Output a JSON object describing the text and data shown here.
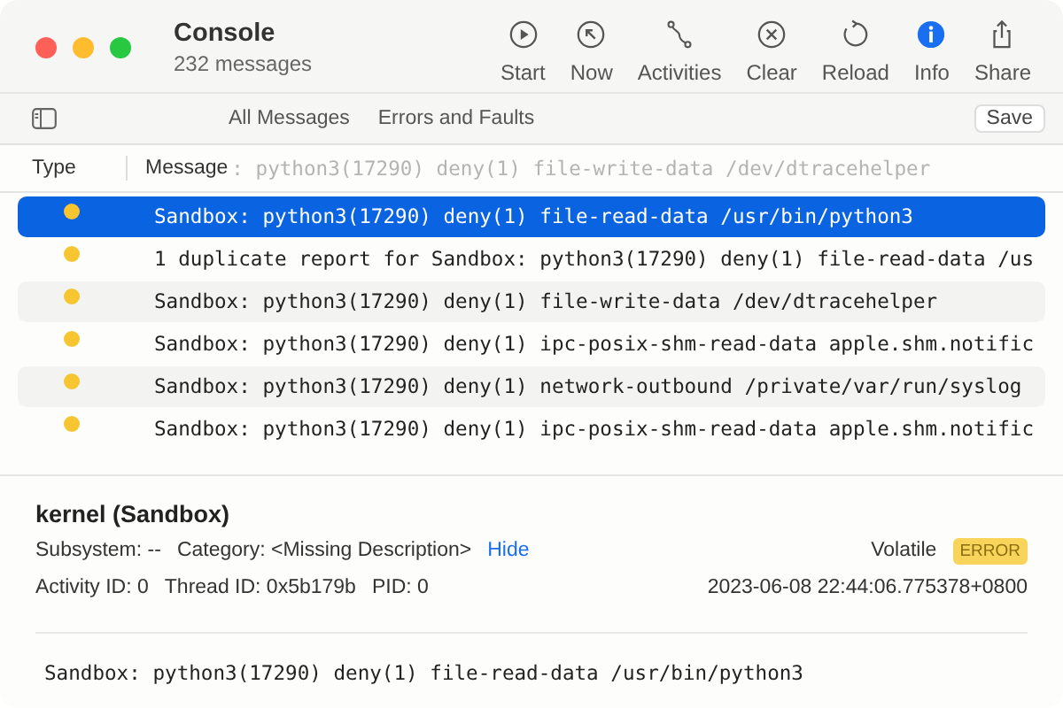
{
  "window": {
    "title": "Console",
    "subtitle": "232 messages"
  },
  "toolbar": [
    {
      "label": "Start",
      "active": false
    },
    {
      "label": "Now",
      "active": false
    },
    {
      "label": "Activities",
      "active": false
    },
    {
      "label": "Clear",
      "active": false
    },
    {
      "label": "Reload",
      "active": false
    },
    {
      "label": "Info",
      "active": true
    },
    {
      "label": "Share",
      "active": false
    }
  ],
  "filters": [
    {
      "label": "All Messages"
    },
    {
      "label": "Errors and Faults"
    }
  ],
  "save_button": "Save",
  "table": {
    "columns": [
      "Type",
      "Message"
    ],
    "scrolled_text": ": python3(17290) deny(1) file-write-data /dev/dtracehelper",
    "rows": [
      {
        "message": "Sandbox: python3(17290) deny(1) file-read-data /usr/bin/python3",
        "color": "#f7c530",
        "selected": true
      },
      {
        "message": "1 duplicate report for Sandbox: python3(17290) deny(1) file-read-data /us",
        "color": "#f7c530",
        "selected": false
      },
      {
        "message": "Sandbox: python3(17290) deny(1) file-write-data /dev/dtracehelper",
        "color": "#f7c530",
        "selected": false
      },
      {
        "message": "Sandbox: python3(17290) deny(1) ipc-posix-shm-read-data apple.shm.notific",
        "color": "#f7c530",
        "selected": false
      },
      {
        "message": "Sandbox: python3(17290) deny(1) network-outbound /private/var/run/syslog",
        "color": "#f7c530",
        "selected": false
      },
      {
        "message": "Sandbox: python3(17290) deny(1) ipc-posix-shm-read-data apple.shm.notific",
        "color": "#f7c530",
        "selected": false
      }
    ]
  },
  "detail": {
    "title": "kernel (Sandbox)",
    "subsystem": "Subsystem: --",
    "category": "Category: <Missing Description>",
    "hide_link": "Hide",
    "volatile": "Volatile",
    "badge": "ERROR",
    "activity_id": "Activity ID: 0",
    "thread_id": "Thread ID: 0x5b179b",
    "pid": "PID: 0",
    "timestamp": "2023-06-08 22:44:06.775378+0800",
    "message": "Sandbox: python3(17290) deny(1) file-read-data /usr/bin/python3"
  }
}
